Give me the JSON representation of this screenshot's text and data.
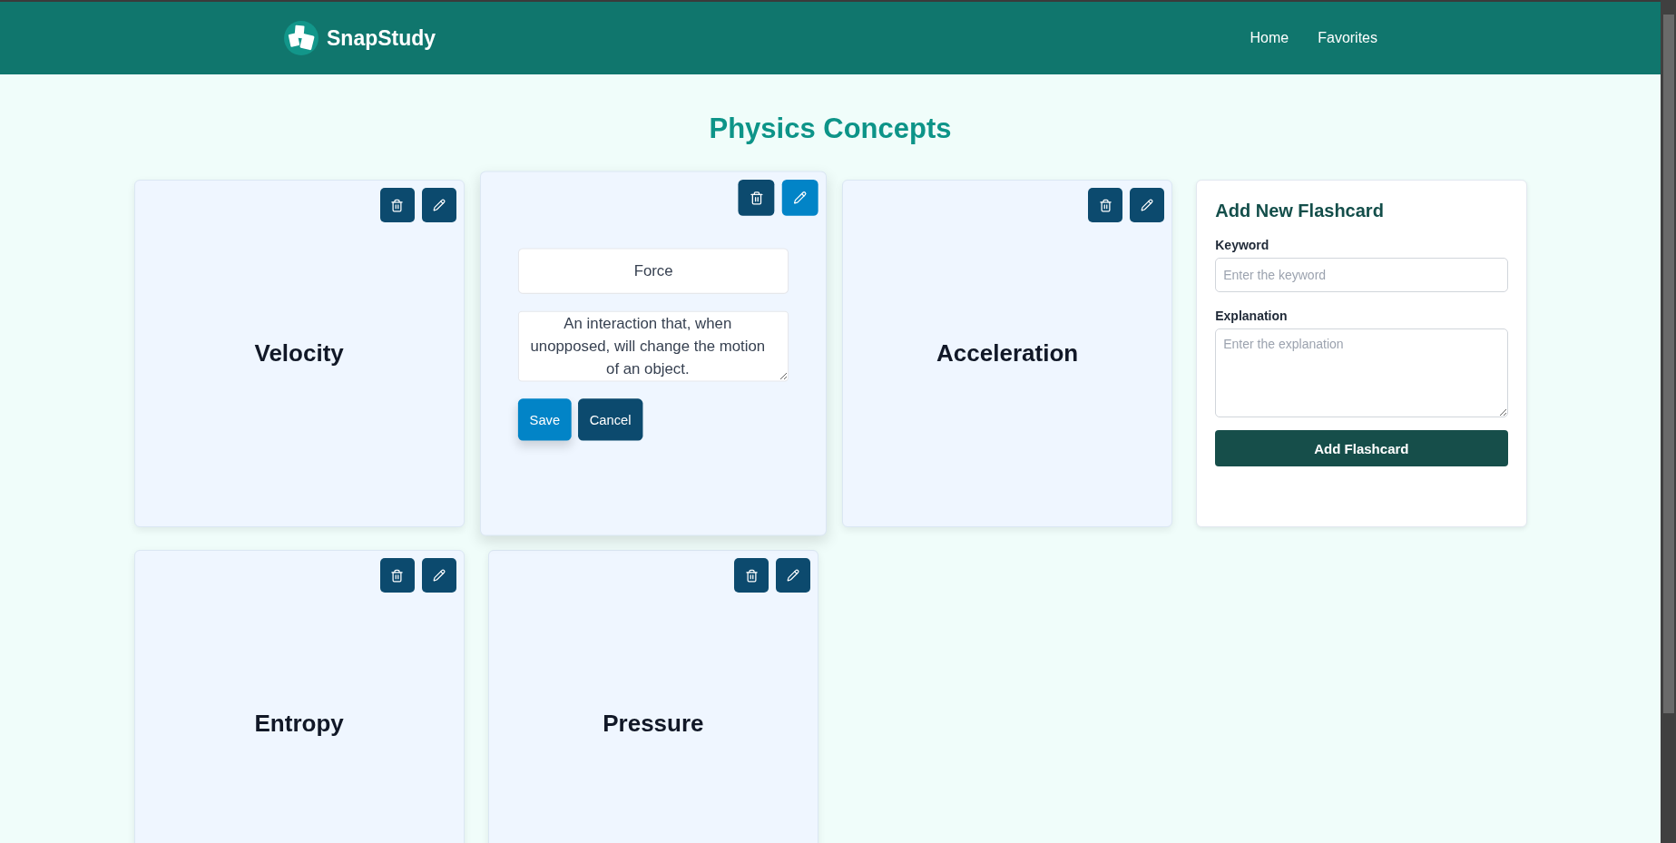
{
  "header": {
    "brand": "SnapStudy",
    "nav": [
      {
        "label": "Home"
      },
      {
        "label": "Favorites"
      }
    ]
  },
  "page_title": "Physics Concepts",
  "flashcards": [
    {
      "keyword": "Velocity",
      "editing": false
    },
    {
      "keyword": "Force",
      "explanation": "An interaction that, when unopposed, will change the motion of an object.",
      "editing": true,
      "save_label": "Save",
      "cancel_label": "Cancel"
    },
    {
      "keyword": "Acceleration",
      "editing": false
    },
    {
      "keyword": "Entropy",
      "editing": false
    },
    {
      "keyword": "Pressure",
      "editing": false
    }
  ],
  "form": {
    "title": "Add New Flashcard",
    "keyword_label": "Keyword",
    "keyword_placeholder": "Enter the keyword",
    "explanation_label": "Explanation",
    "explanation_placeholder": "Enter the explanation",
    "submit": "Add Flashcard"
  }
}
